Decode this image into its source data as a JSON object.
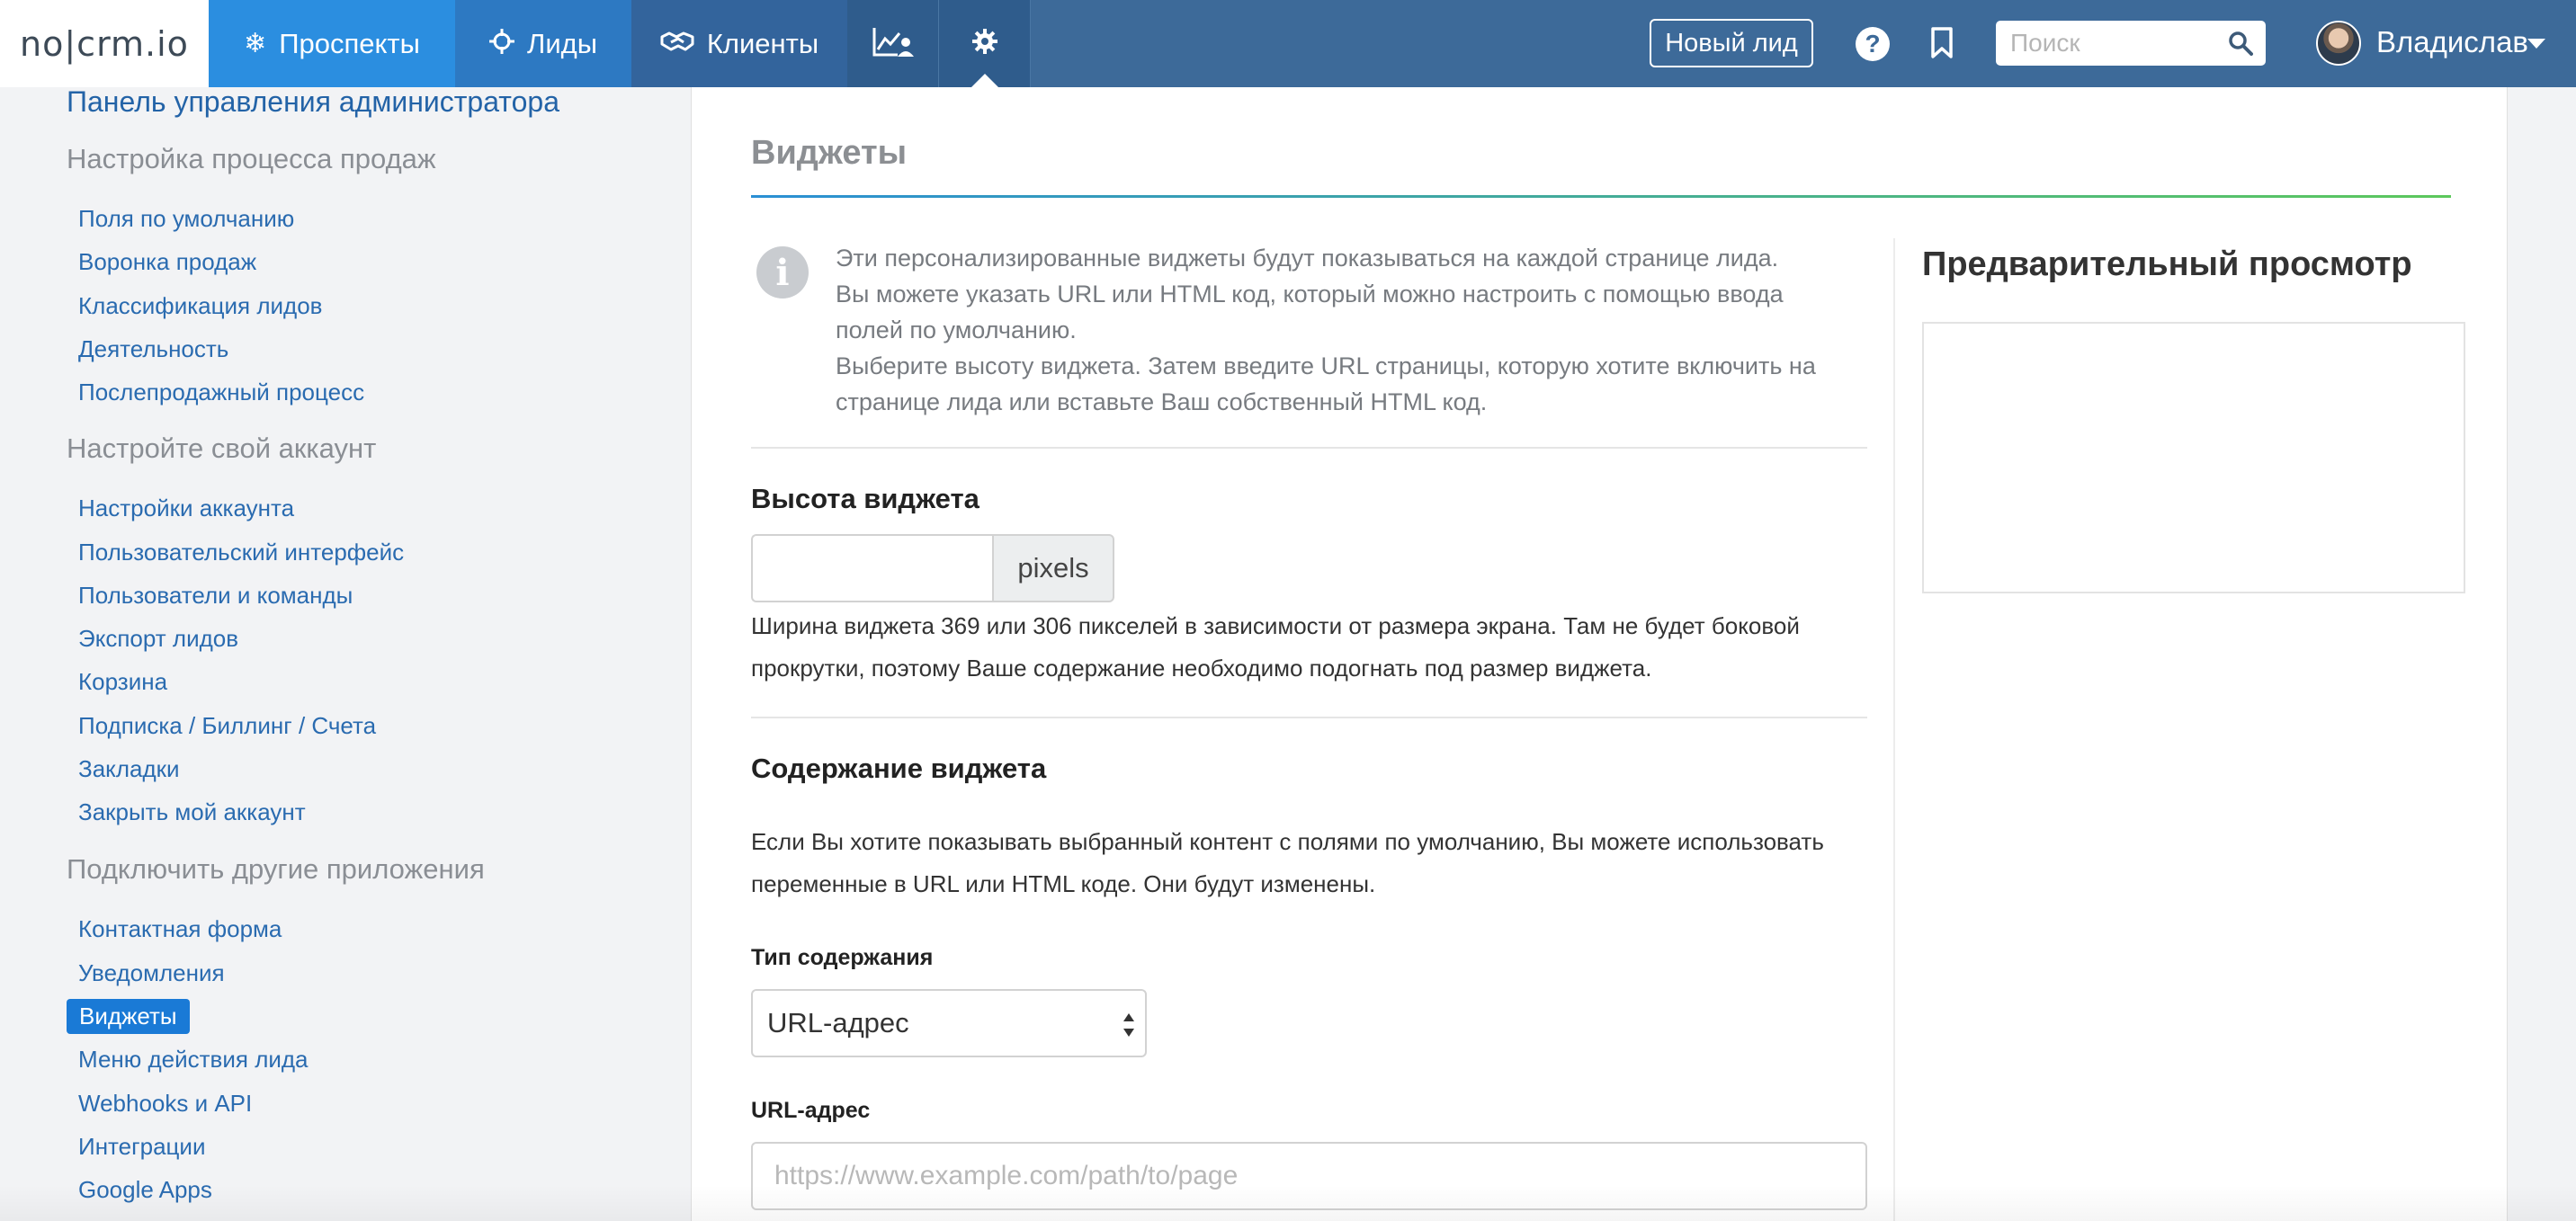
{
  "header": {
    "logo": "no|crm.io",
    "tabs": [
      {
        "label": "Проспекты",
        "icon": "snowflake-icon"
      },
      {
        "label": "Лиды",
        "icon": "crosshair-icon"
      },
      {
        "label": "Клиенты",
        "icon": "handshake-icon"
      }
    ],
    "reports_icon": "chart-user-icon",
    "settings_icon": "gear-icon",
    "new_lead_label": "Новый лид",
    "help_icon": "question-icon",
    "bookmark_icon": "bookmark-icon",
    "search_placeholder": "Поиск",
    "user_name": "Владислав"
  },
  "sidebar": {
    "admin_title": "Панель управления администратора",
    "sections": [
      {
        "title": "Настройка процесса продаж",
        "items": [
          "Поля по умолчанию",
          "Воронка продаж",
          "Классификация лидов",
          "Деятельность",
          "Послепродажный процесс"
        ]
      },
      {
        "title": "Настройте свой аккаунт",
        "items": [
          "Настройки аккаунта",
          "Пользовательский интерфейс",
          "Пользователи и команды",
          "Экспорт лидов",
          "Корзина",
          "Подписка / Биллинг / Счета",
          "Закладки",
          "Закрыть мой аккаунт"
        ]
      },
      {
        "title": "Подключить другие приложения",
        "items": [
          "Контактная форма",
          "Уведомления",
          "Виджеты",
          "Меню действия лида",
          "Webhooks и API",
          "Интеграции",
          "Google Apps"
        ]
      }
    ],
    "active_item": "Виджеты"
  },
  "main": {
    "title": "Виджеты",
    "info_lines": [
      "Эти персонализированные виджеты будут показываться на каждой странице лида.",
      "Вы можете указать URL или HTML код, который можно настроить с помощью ввода полей по умолчанию.",
      "Выберите высоту виджета. Затем введите URL страницы, которую хотите включить на странице лида или вставьте Ваш собственный HTML код."
    ],
    "height_heading": "Высота виджета",
    "height_value": "",
    "height_unit": "pixels",
    "height_hint": "Ширина виджета 369 или 306 пикселей в зависимости от размера экрана. Там не будет боковой прокрутки, поэтому Ваше содержание необходимо подогнать под размер виджета.",
    "content_heading": "Содержание виджета",
    "content_hint": "Если Вы хотите показывать выбранный контент с полями по умолчанию, Вы можете использовать переменные в URL или HTML коде. Они будут изменены.",
    "content_type_label": "Тип содержания",
    "content_type_value": "URL-адрес",
    "url_label": "URL-адрес",
    "url_placeholder": "https://www.example.com/path/to/page",
    "url_value": "",
    "preview_title": "Предварительный просмотр"
  },
  "colors": {
    "topbar": "#3d6a99",
    "tab_prospects": "#2b8ee0",
    "tab_leads": "#2d79c2",
    "link": "#2a6bb0",
    "active_item_bg": "#1a7ad6"
  }
}
